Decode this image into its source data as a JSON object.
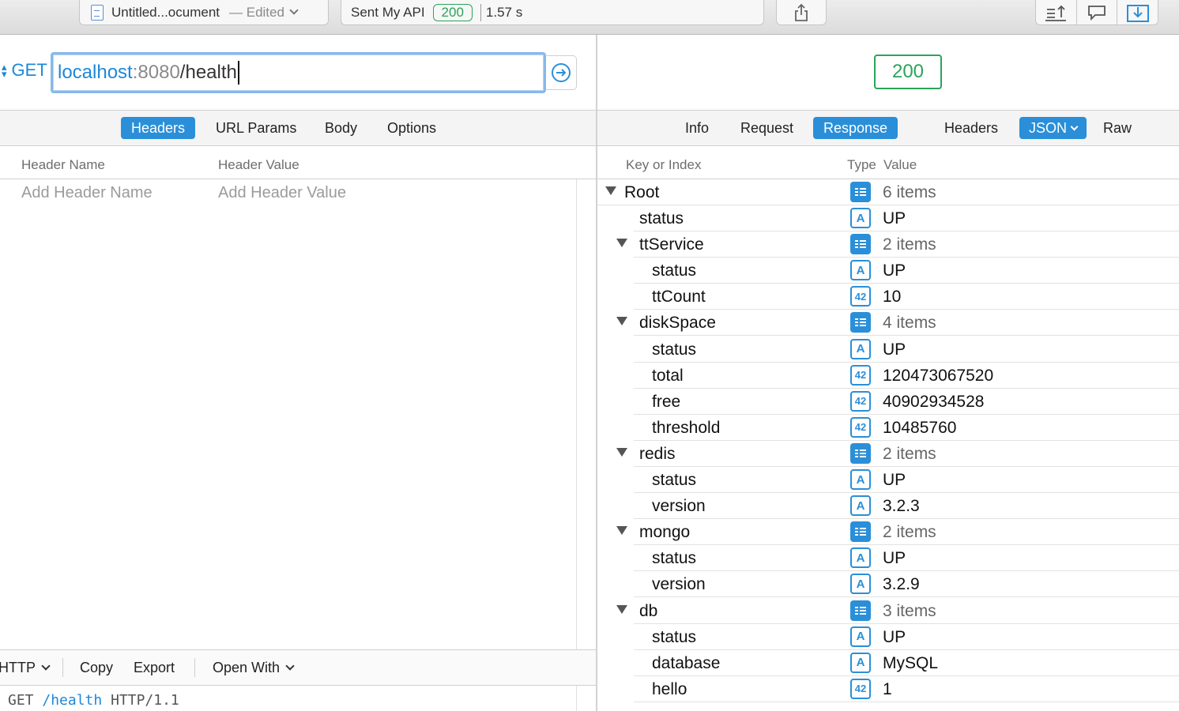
{
  "titlebar": {
    "doc_name": "Untitled...ocument",
    "doc_state": "— Edited",
    "request_name": "Sent My API",
    "status_code": "200",
    "duration": "1.57 s"
  },
  "request": {
    "method": "GET",
    "url_host": "localhost",
    "url_port": ":8080",
    "url_path": "/health"
  },
  "request_tabs": [
    "Headers",
    "URL Params",
    "Body",
    "Options"
  ],
  "headers_table": {
    "col_name": "Header Name",
    "col_value": "Header Value",
    "placeholder_name": "Add Header Name",
    "placeholder_value": "Add Header Value"
  },
  "bottom_bar": {
    "format": "HTTP",
    "copy": "Copy",
    "export": "Export",
    "open_with": "Open With"
  },
  "code_preview": {
    "method": "GET",
    "path": "/health",
    "protocol": "HTTP/1.1"
  },
  "response": {
    "status_code": "200",
    "tabs": [
      "Info",
      "Request",
      "Response"
    ],
    "view_tabs": [
      "Headers",
      "JSON",
      "Raw"
    ],
    "col_key": "Key or Index",
    "col_type": "Type",
    "col_value": "Value"
  },
  "json_tree": [
    {
      "key": "Root",
      "type": "obj",
      "value": "6 items",
      "level": 0,
      "expanded": true
    },
    {
      "key": "status",
      "type": "str",
      "value": "UP",
      "level": 1
    },
    {
      "key": "ttService",
      "type": "obj",
      "value": "2 items",
      "level": 1,
      "expanded": true
    },
    {
      "key": "status",
      "type": "str",
      "value": "UP",
      "level": 2
    },
    {
      "key": "ttCount",
      "type": "num",
      "value": "10",
      "level": 2
    },
    {
      "key": "diskSpace",
      "type": "obj",
      "value": "4 items",
      "level": 1,
      "expanded": true
    },
    {
      "key": "status",
      "type": "str",
      "value": "UP",
      "level": 2
    },
    {
      "key": "total",
      "type": "num",
      "value": "120473067520",
      "level": 2
    },
    {
      "key": "free",
      "type": "num",
      "value": "40902934528",
      "level": 2
    },
    {
      "key": "threshold",
      "type": "num",
      "value": "10485760",
      "level": 2
    },
    {
      "key": "redis",
      "type": "obj",
      "value": "2 items",
      "level": 1,
      "expanded": true
    },
    {
      "key": "status",
      "type": "str",
      "value": "UP",
      "level": 2
    },
    {
      "key": "version",
      "type": "str",
      "value": "3.2.3",
      "level": 2
    },
    {
      "key": "mongo",
      "type": "obj",
      "value": "2 items",
      "level": 1,
      "expanded": true
    },
    {
      "key": "status",
      "type": "str",
      "value": "UP",
      "level": 2
    },
    {
      "key": "version",
      "type": "str",
      "value": "3.2.9",
      "level": 2
    },
    {
      "key": "db",
      "type": "obj",
      "value": "3 items",
      "level": 1,
      "expanded": true
    },
    {
      "key": "status",
      "type": "str",
      "value": "UP",
      "level": 2
    },
    {
      "key": "database",
      "type": "str",
      "value": "MySQL",
      "level": 2
    },
    {
      "key": "hello",
      "type": "num",
      "value": "1",
      "level": 2
    }
  ],
  "type_labels": {
    "str": "A",
    "num": "42"
  },
  "colors": {
    "accent": "#2a8fd8",
    "success": "#2aa45a"
  }
}
